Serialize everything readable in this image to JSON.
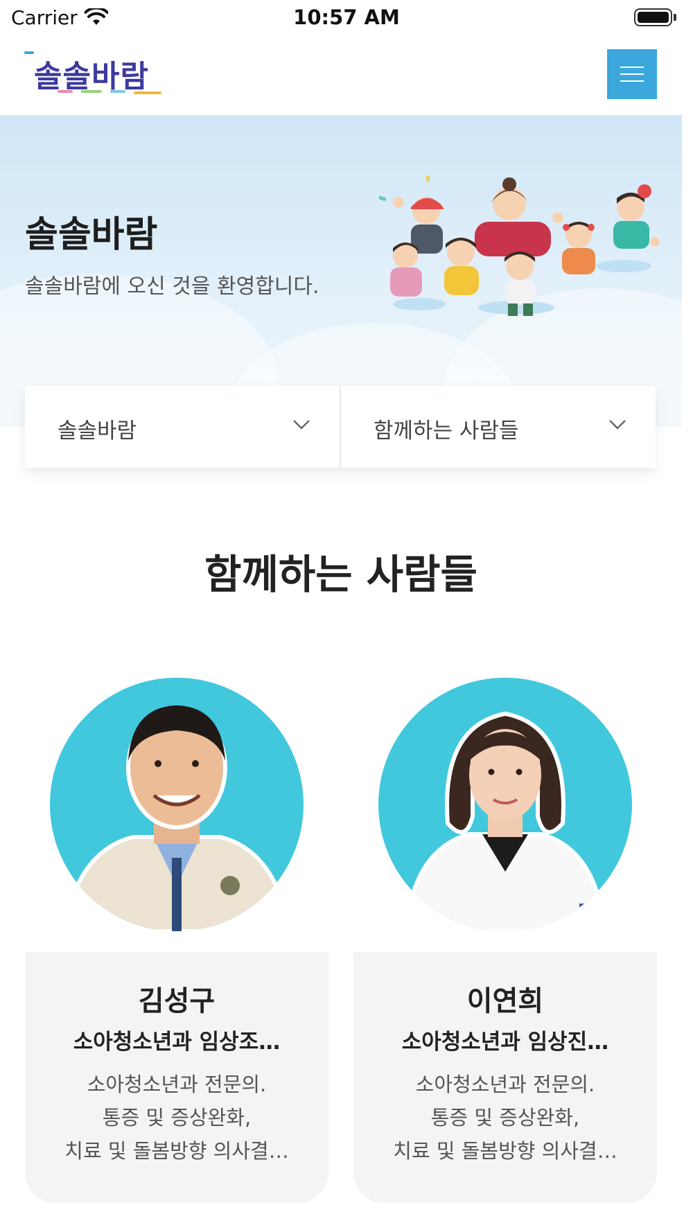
{
  "status_bar": {
    "carrier": "Carrier",
    "time": "10:57 AM"
  },
  "header": {
    "logo_text": "솔솔바람",
    "menu_icon": "hamburger-menu-icon",
    "accent_color": "#3ba7dd"
  },
  "hero": {
    "title": "솔솔바람",
    "subtitle": "솔솔바람에 오신 것을 환영합니다."
  },
  "nav_dropdowns": [
    {
      "label": "솔솔바람",
      "icon": "chevron-down-icon"
    },
    {
      "label": "함께하는 사람들",
      "icon": "chevron-down-icon"
    }
  ],
  "section": {
    "title": "함께하는 사람들"
  },
  "people": [
    {
      "name": "김성구",
      "role": "소아청소년과 임상조…",
      "description": [
        "소아청소년과 전문의.",
        "통증 및 증상완화,",
        "치료 및 돌봄방향 의사결…"
      ]
    },
    {
      "name": "이연희",
      "role": "소아청소년과 임상진…",
      "description": [
        "소아청소년과 전문의.",
        "통증 및 증상완화,",
        "치료 및 돌봄방향 의사결…"
      ]
    }
  ]
}
